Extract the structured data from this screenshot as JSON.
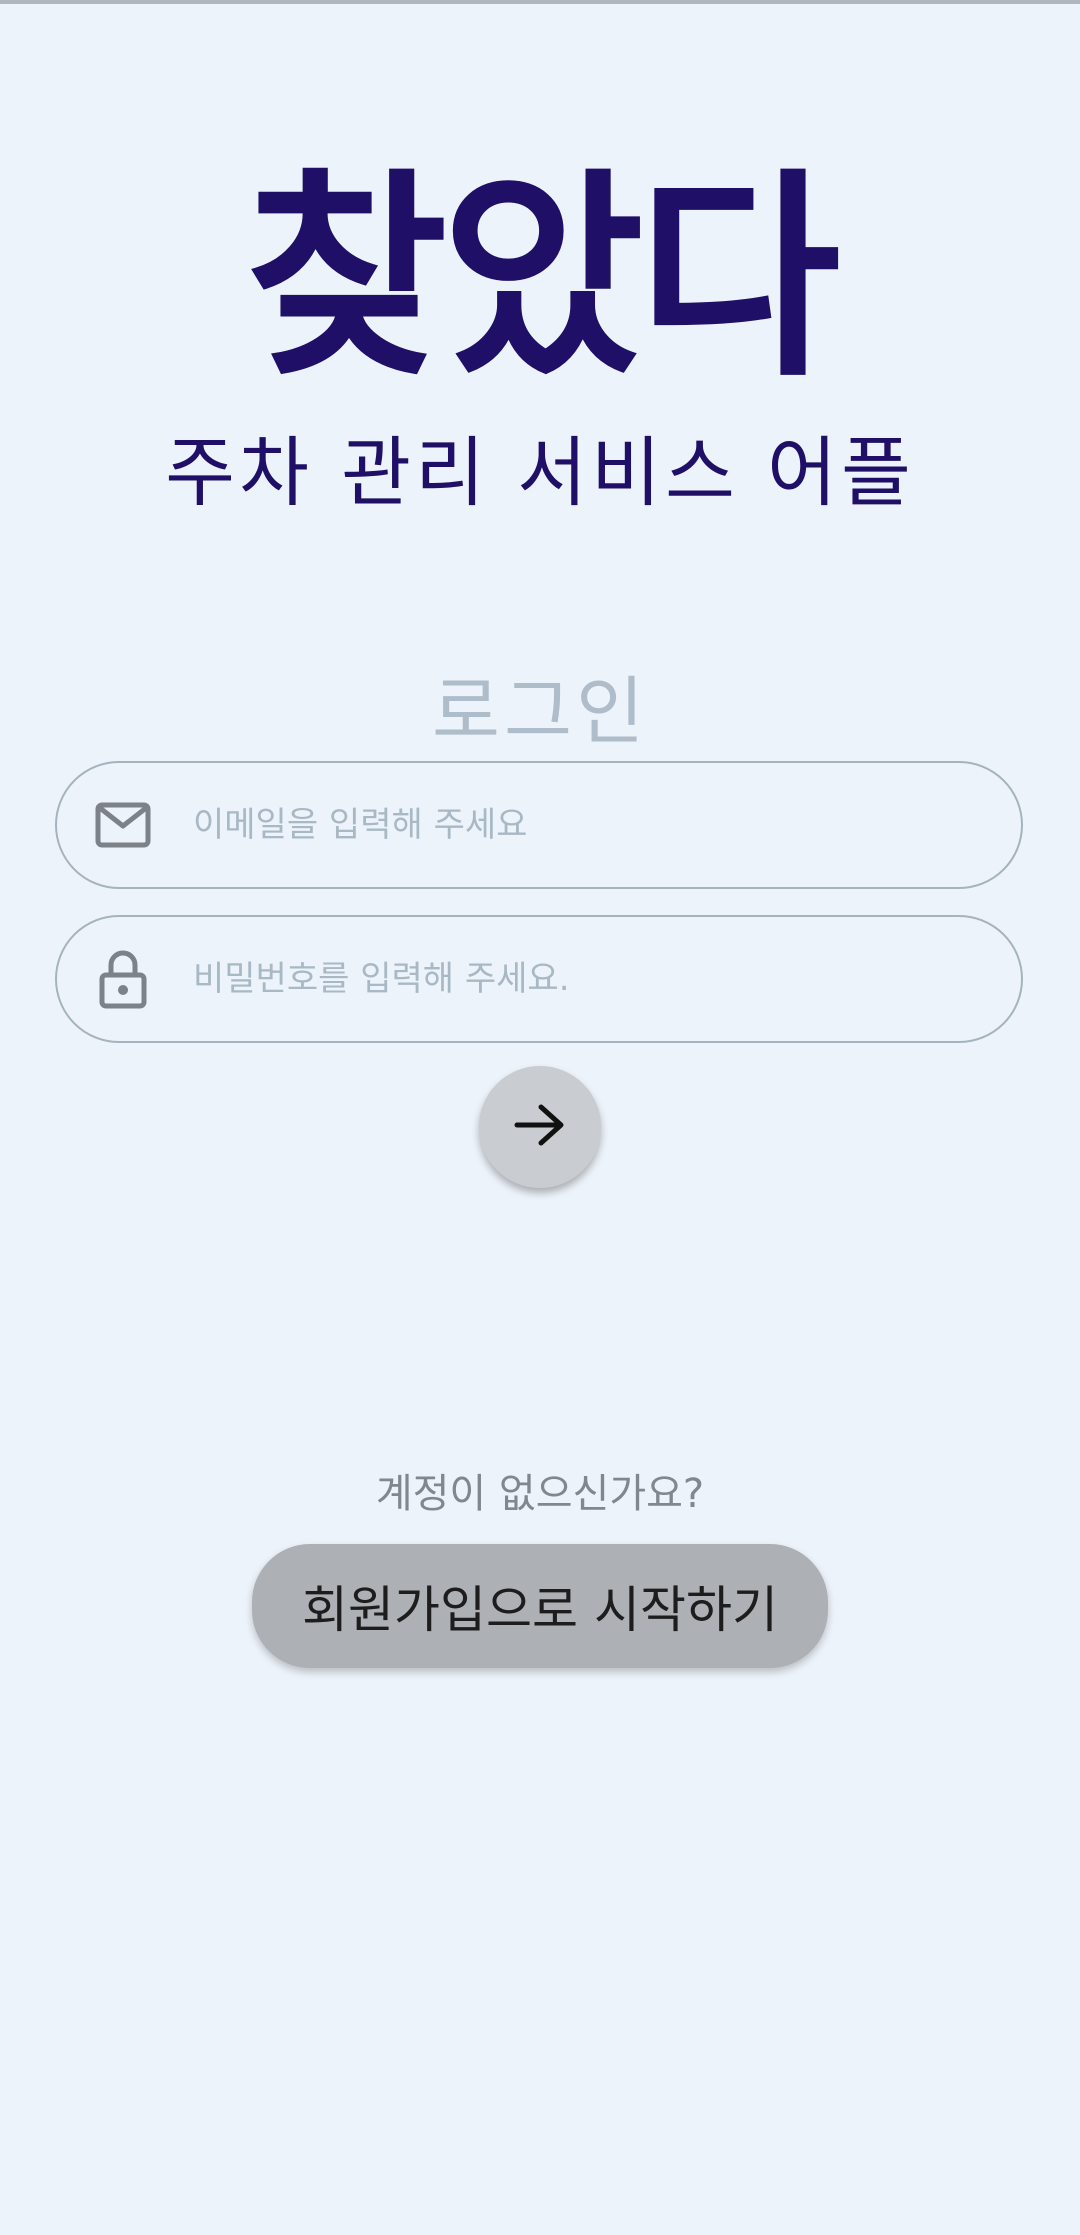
{
  "app": {
    "title": "찾았다",
    "subtitle": "주차 관리 서비스 어플"
  },
  "login": {
    "heading": "로그인",
    "email": {
      "value": "",
      "placeholder": "이메일을 입력해 주세요",
      "icon": "mail-icon"
    },
    "password": {
      "value": "",
      "placeholder": "비밀번호를 입력해 주세요.",
      "icon": "lock-icon"
    },
    "submit_icon": "arrow-right-icon"
  },
  "signup": {
    "prompt": "계정이 없으신가요?",
    "button_label": "회원가입으로 시작하기"
  },
  "colors": {
    "background": "#edf3fa",
    "brand": "#1f0f66",
    "muted": "#aebdc9",
    "button_gray": "#adb0b5"
  }
}
